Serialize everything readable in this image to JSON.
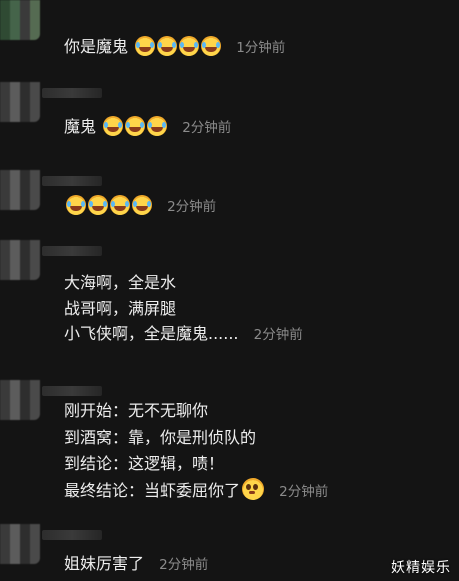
{
  "comments": [
    {
      "text": "你是魔鬼",
      "emojis": [
        "cry-laugh",
        "cry-laugh",
        "cry-laugh",
        "cry-laugh"
      ],
      "time": "1分钟前"
    },
    {
      "text": "魔鬼",
      "emojis": [
        "cry-laugh",
        "cry-laugh",
        "cry-laugh"
      ],
      "time": "2分钟前"
    },
    {
      "text": "",
      "emojis": [
        "cry-laugh",
        "cry-laugh",
        "cry-laugh",
        "cry-laugh"
      ],
      "time": "2分钟前"
    },
    {
      "lines": [
        "大海啊，全是水",
        "战哥啊，满屏腿",
        "小飞侠啊，全是魔鬼......"
      ],
      "time": "2分钟前"
    },
    {
      "lines": [
        "刚开始：无不无聊你",
        "到酒窝：靠，你是刑侦队的",
        "到结论：这逻辑，啧！",
        "最终结论：当虾委屈你了"
      ],
      "last_emoji": "pleading-face",
      "time": "2分钟前"
    },
    {
      "text": "姐妹厉害了",
      "time": "2分钟前"
    }
  ],
  "watermark": "妖精娱乐",
  "colors": {
    "background": "#141414",
    "text": "#ededed",
    "timestamp": "#8b8b8b"
  }
}
